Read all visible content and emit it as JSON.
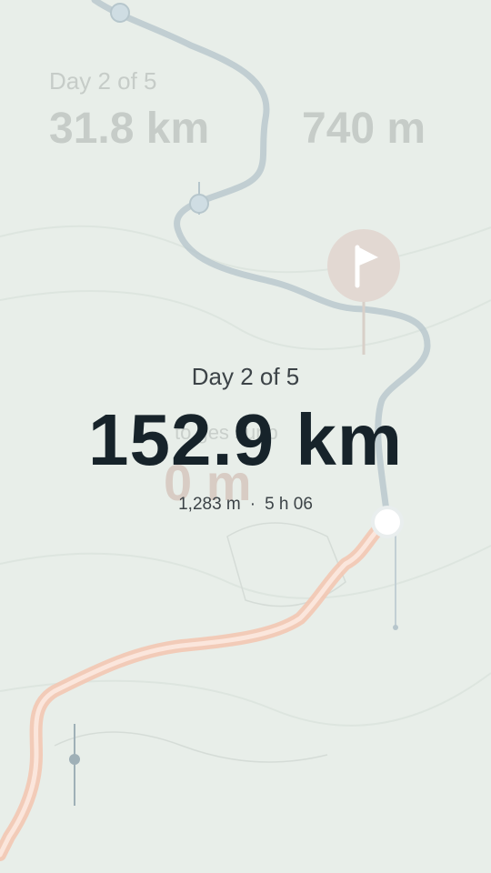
{
  "background_ghost": {
    "day": "Day 2 of 5",
    "distance": "31.8 km",
    "elevation": "740 m",
    "mid_text": "to ges sunb",
    "big_text": "0 m"
  },
  "overlay": {
    "day": "Day 2 of 5",
    "distance": "152.9 km",
    "elevation": "1,283 m",
    "separator": "·",
    "duration": "5 h 06"
  },
  "colors": {
    "route_done": "#f2b9a0",
    "route_upcoming": "#9fb3bc",
    "text_primary": "#17232a",
    "map_bg": "#e9efea"
  },
  "icons": {
    "flag_marker": "flag-icon",
    "waypoint": "waypoint-marker",
    "current_position": "position-marker"
  }
}
